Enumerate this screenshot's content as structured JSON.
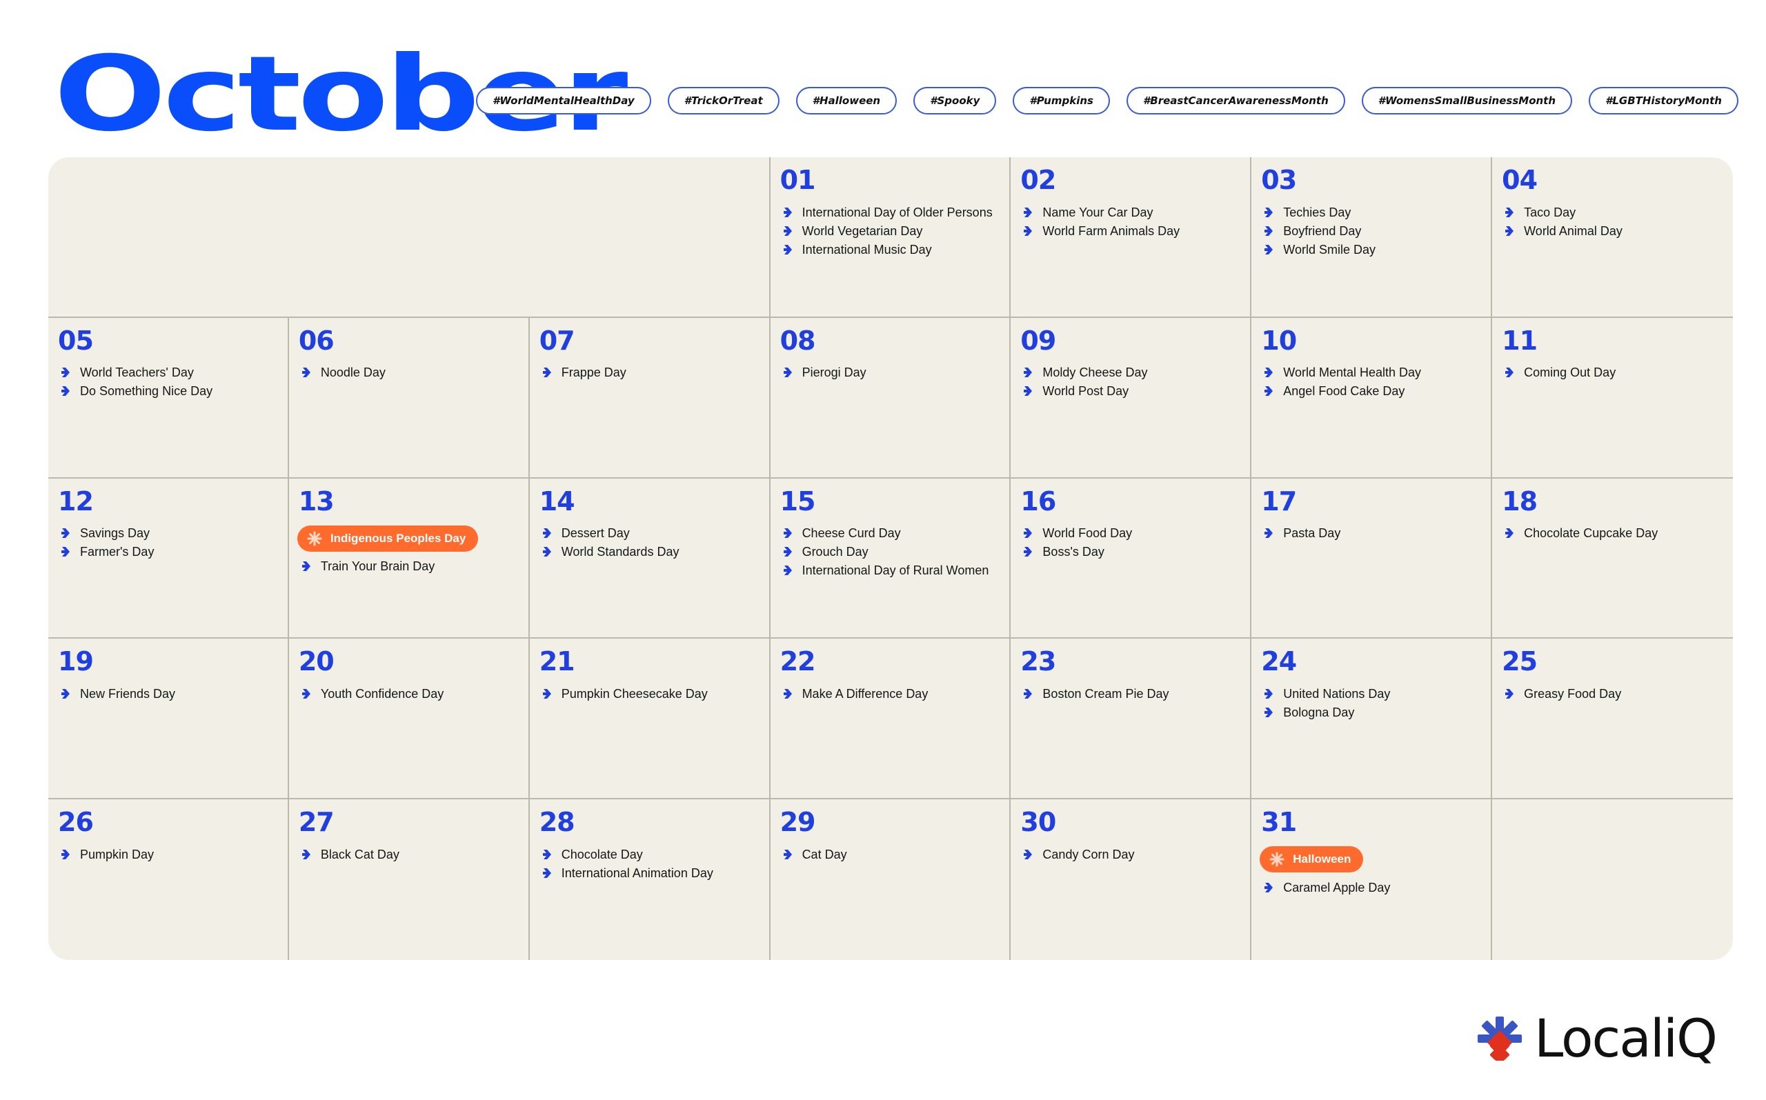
{
  "header": {
    "title": "October",
    "hashtags": [
      "#WorldMentalHealthDay",
      "#TrickOrTreat",
      "#Halloween",
      "#Spooky",
      "#Pumpkins",
      "#BreastCancerAwarenessMonth",
      "#WomensSmallBusinessMonth",
      "#LGBTHistoryMonth"
    ]
  },
  "colors": {
    "accent_blue": "#0a4dfb",
    "daynum_blue": "#1f3fe0",
    "highlight_orange": "#ff6b2c",
    "card_bg": "#f2efe6"
  },
  "calendar": {
    "leading_blank_days": 3,
    "days": [
      {
        "num": "01",
        "events": [
          "International Day of Older Persons",
          "World Vegetarian Day",
          "International Music Day"
        ]
      },
      {
        "num": "02",
        "events": [
          "Name Your Car Day",
          "World Farm Animals Day"
        ]
      },
      {
        "num": "03",
        "events": [
          "Techies Day",
          "Boyfriend Day",
          "World Smile Day"
        ]
      },
      {
        "num": "04",
        "events": [
          "Taco Day",
          "World Animal Day"
        ]
      },
      {
        "num": "05",
        "events": [
          "World Teachers' Day",
          "Do Something Nice Day"
        ]
      },
      {
        "num": "06",
        "events": [
          "Noodle Day"
        ]
      },
      {
        "num": "07",
        "events": [
          "Frappe Day"
        ]
      },
      {
        "num": "08",
        "events": [
          "Pierogi Day"
        ]
      },
      {
        "num": "09",
        "events": [
          "Moldy Cheese Day",
          "World Post Day"
        ]
      },
      {
        "num": "10",
        "events": [
          "World Mental Health Day",
          "Angel Food Cake Day"
        ]
      },
      {
        "num": "11",
        "events": [
          "Coming Out Day"
        ]
      },
      {
        "num": "12",
        "events": [
          "Savings Day",
          "Farmer's Day"
        ]
      },
      {
        "num": "13",
        "highlight": "Indigenous Peoples Day",
        "events": [
          "Train Your Brain Day"
        ]
      },
      {
        "num": "14",
        "events": [
          "Dessert Day",
          "World Standards Day"
        ]
      },
      {
        "num": "15",
        "events": [
          "Cheese Curd Day",
          "Grouch Day",
          "International Day of Rural Women"
        ]
      },
      {
        "num": "16",
        "events": [
          "World Food Day",
          "Boss's Day"
        ]
      },
      {
        "num": "17",
        "events": [
          "Pasta Day"
        ]
      },
      {
        "num": "18",
        "events": [
          "Chocolate Cupcake Day"
        ]
      },
      {
        "num": "19",
        "events": [
          "New Friends Day"
        ]
      },
      {
        "num": "20",
        "events": [
          "Youth Confidence Day"
        ]
      },
      {
        "num": "21",
        "events": [
          "Pumpkin Cheesecake Day"
        ]
      },
      {
        "num": "22",
        "events": [
          "Make A Difference Day"
        ]
      },
      {
        "num": "23",
        "events": [
          "Boston Cream Pie Day"
        ]
      },
      {
        "num": "24",
        "events": [
          "United Nations Day",
          "Bologna Day"
        ]
      },
      {
        "num": "25",
        "events": [
          "Greasy Food Day"
        ]
      },
      {
        "num": "26",
        "events": [
          "Pumpkin Day"
        ]
      },
      {
        "num": "27",
        "events": [
          "Black Cat Day"
        ]
      },
      {
        "num": "28",
        "events": [
          "Chocolate Day",
          "International Animation Day"
        ]
      },
      {
        "num": "29",
        "events": [
          "Cat Day"
        ]
      },
      {
        "num": "30",
        "events": [
          "Candy Corn Day"
        ]
      },
      {
        "num": "31",
        "highlight": "Halloween",
        "events": [
          "Caramel Apple Day"
        ]
      }
    ]
  },
  "icons": {
    "event_bullet": "chevron-right-icon",
    "highlight_marker": "burst-icon",
    "logo_mark": "localiq-asterisk-icon"
  },
  "footer": {
    "logo_text": "LocaliQ"
  }
}
